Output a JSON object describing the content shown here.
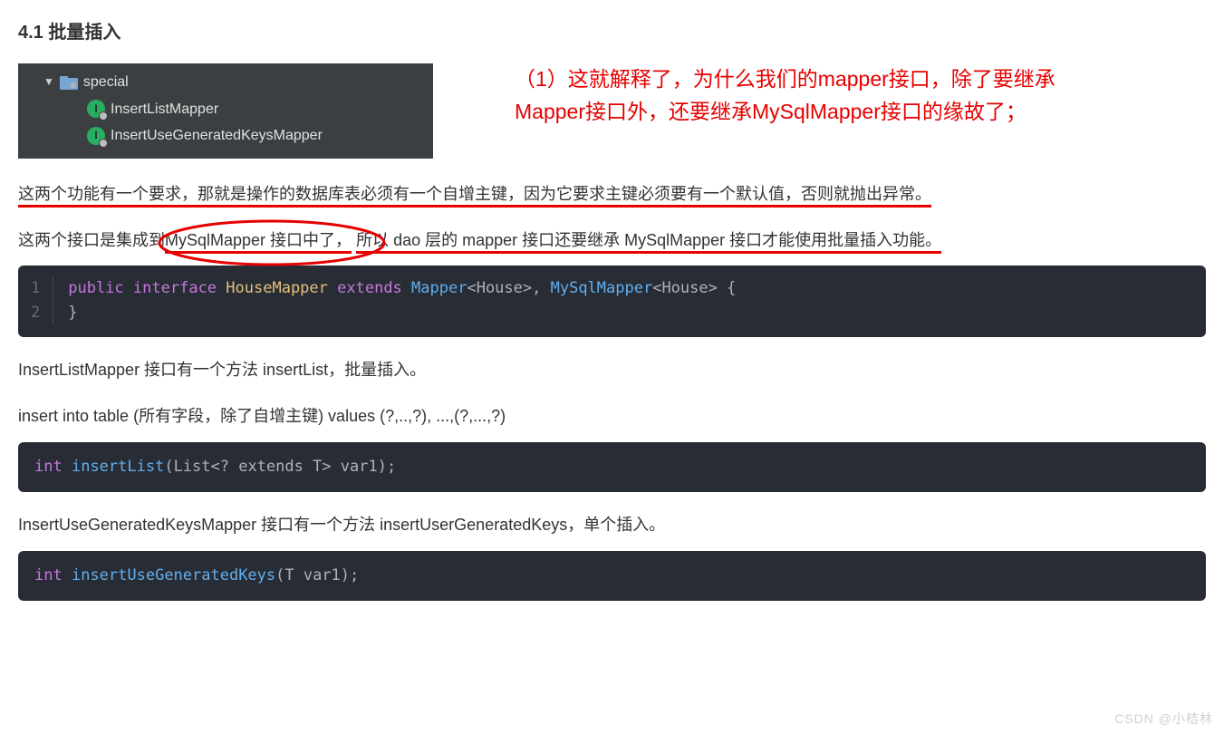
{
  "heading": "4.1 批量插入",
  "ide": {
    "folder": "special",
    "items": [
      "InsertListMapper",
      "InsertUseGeneratedKeysMapper"
    ],
    "iconLetter": "I"
  },
  "annotation": {
    "line1": "（1）这就解释了，为什么我们的mapper接口，除了要继承",
    "line2": "Mapper接口外，还要继承MySqlMapper接口的缘故了；"
  },
  "para1": {
    "pre": "这两个功能有一个要求，那就是操作的数据库表必须有一个自增主键，因为它要求主键必须要有一个默认值，否则就抛出异常。"
  },
  "para2": {
    "pre": "这两个接口是集成到",
    "circled": " MySqlMapper 接口中了，",
    "post": "所以 dao 层的 mapper 接口还要继承 MySqlMapper 接口才能使用批量插入功能。"
  },
  "code1": {
    "lines": [
      "1",
      "2"
    ],
    "tokens": {
      "public": "public",
      "interface": "interface",
      "HouseMapper": "HouseMapper",
      "extends": "extends",
      "Mapper": "Mapper",
      "gen1": "<House>",
      "comma": ", ",
      "MySqlMapper": "MySqlMapper",
      "gen2": "<House>",
      "open": " {",
      "close": "}"
    }
  },
  "para3": "InsertListMapper 接口有一个方法 insertList，批量插入。",
  "para4": "insert into table (所有字段，除了自增主键) values (?,..,?), ...,(?,...,?)",
  "code2": {
    "ret": "int",
    "fn": "insertList",
    "sig": "(List<? extends T> var1);"
  },
  "para5": "InsertUseGeneratedKeysMapper 接口有一个方法 insertUserGeneratedKeys，单个插入。",
  "code3": {
    "ret": "int",
    "fn": "insertUseGeneratedKeys",
    "sig": "(T var1);"
  },
  "watermark": "CSDN @小桔林"
}
